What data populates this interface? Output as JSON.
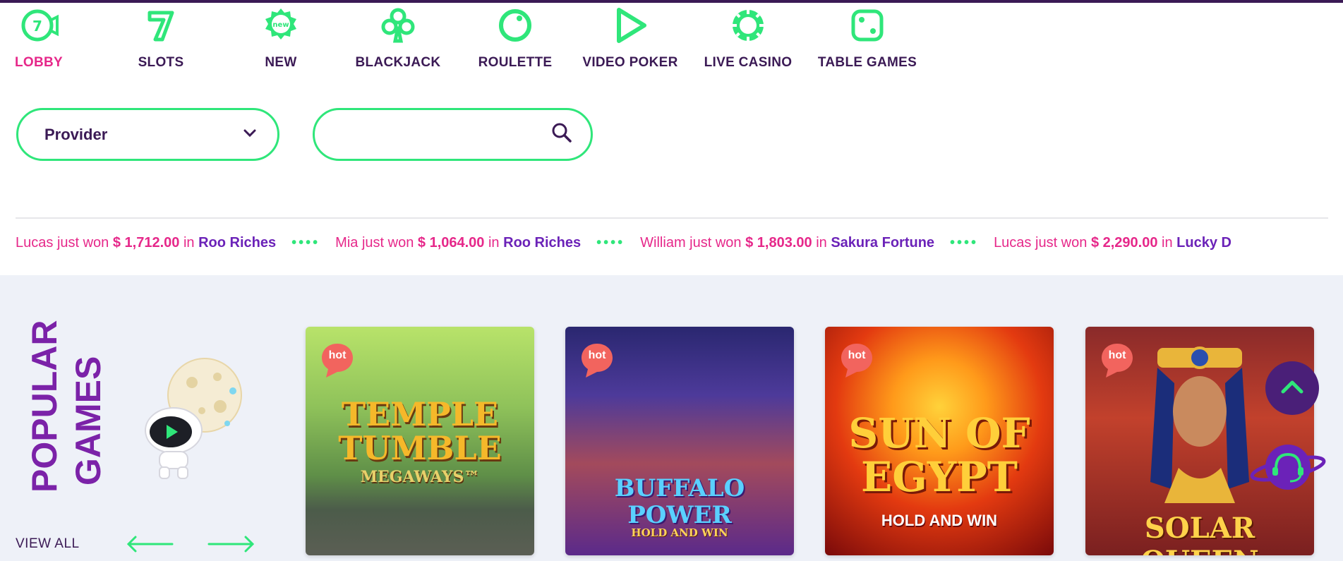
{
  "colors": {
    "accent_green": "#2fe67a",
    "active_pink": "#e6288a",
    "dark_purple": "#3b1a55",
    "game_purple": "#6b22b8"
  },
  "nav": {
    "items": [
      {
        "label": "LOBBY",
        "icon": "lobby-seven-icon",
        "active": true
      },
      {
        "label": "SLOTS",
        "icon": "slots-seven-icon",
        "active": false
      },
      {
        "label": "NEW",
        "icon": "new-badge-icon",
        "icon_text": "new",
        "active": false
      },
      {
        "label": "BLACKJACK",
        "icon": "club-icon",
        "active": false
      },
      {
        "label": "ROULETTE",
        "icon": "roulette-icon",
        "active": false
      },
      {
        "label": "VIDEO POKER",
        "icon": "play-icon",
        "active": false
      },
      {
        "label": "LIVE CASINO",
        "icon": "chip-icon",
        "active": false
      },
      {
        "label": "TABLE GAMES",
        "icon": "dice-icon",
        "active": false
      }
    ]
  },
  "filters": {
    "provider_label": "Provider",
    "search_value": ""
  },
  "ticker": [
    {
      "name": "Lucas",
      "text": "just won",
      "amount": "$ 1,712.00",
      "in": "in",
      "game": "Roo Riches"
    },
    {
      "name": "Mia",
      "text": "just won",
      "amount": "$ 1,064.00",
      "in": "in",
      "game": "Roo Riches"
    },
    {
      "name": "William",
      "text": "just won",
      "amount": "$ 1,803.00",
      "in": "in",
      "game": "Sakura Fortune"
    },
    {
      "name": "Lucas",
      "text": "just won",
      "amount": "$ 2,290.00",
      "in": "in",
      "game": "Lucky D"
    }
  ],
  "popular": {
    "title_line1": "POPULAR",
    "title_line2": "GAMES",
    "view_all": "VIEW ALL",
    "games": [
      {
        "badge": "hot",
        "title_main": "TEMPLE TUMBLE",
        "title_sub": "MEGAWAYS™"
      },
      {
        "badge": "hot",
        "title_main": "BUFFALO POWER",
        "title_sub": "HOLD AND WIN"
      },
      {
        "badge": "hot",
        "title_main": "SUN OF EGYPT",
        "title_sub": "HOLD AND WIN"
      },
      {
        "badge": "hot",
        "title_main": "SOLAR QUEEN",
        "title_sub": ""
      }
    ]
  }
}
